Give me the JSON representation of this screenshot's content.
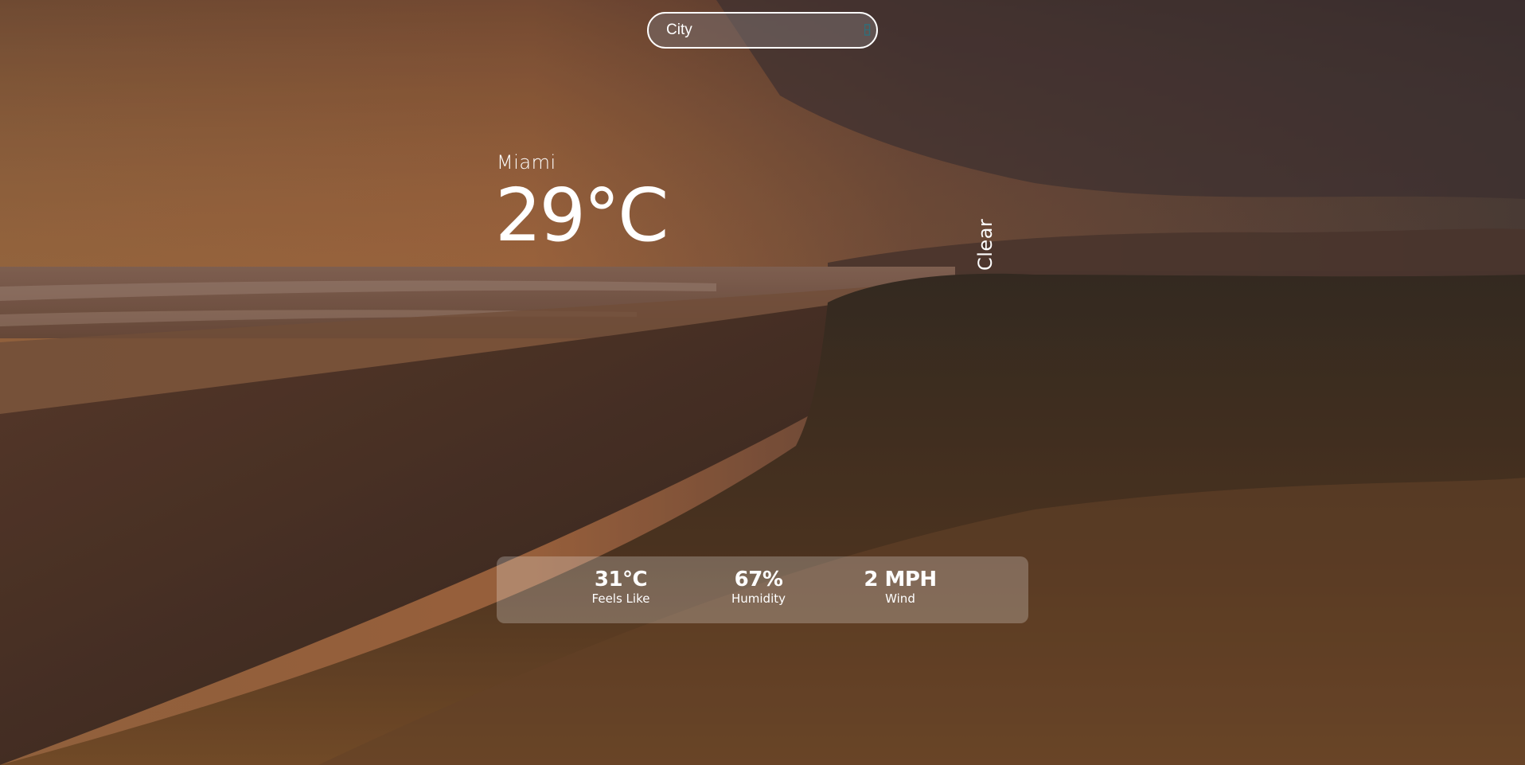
{
  "search": {
    "placeholder": "City"
  },
  "weather": {
    "city": "Miami",
    "temperature": "29°C",
    "condition": "Clear"
  },
  "stats": [
    {
      "value": "31°C",
      "label": "Feels Like"
    },
    {
      "value": "67%",
      "label": "Humidity"
    },
    {
      "value": "2 MPH",
      "label": "Wind"
    }
  ],
  "icons": {
    "search": "search-icon"
  },
  "colors": {
    "text": "#ffffff",
    "search_icon": "#2f6f7a"
  }
}
